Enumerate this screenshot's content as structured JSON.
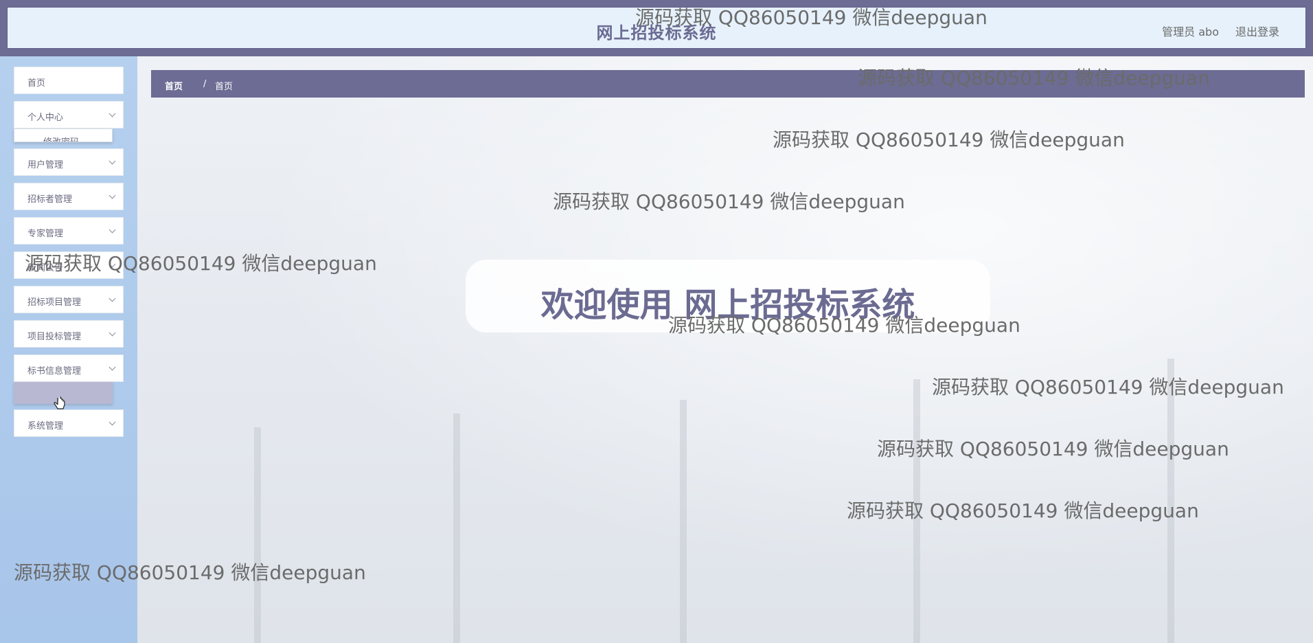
{
  "header": {
    "title": "网上招投标系统",
    "user_info": "管理员 abo",
    "logout_label": "退出登录"
  },
  "sidebar": {
    "items": [
      {
        "label": "首页",
        "has_arrow": false
      },
      {
        "label": "个人中心",
        "has_arrow": true
      },
      {
        "label": "用户管理",
        "has_arrow": true
      },
      {
        "label": "招标者管理",
        "has_arrow": true
      },
      {
        "label": "专家管理",
        "has_arrow": true
      },
      {
        "label": "新闻公告",
        "has_arrow": true
      },
      {
        "label": "招标项目管理",
        "has_arrow": true
      },
      {
        "label": "项目投标管理",
        "has_arrow": true
      },
      {
        "label": "标书信息管理",
        "has_arrow": true
      },
      {
        "label": "系统管理",
        "has_arrow": true
      }
    ],
    "submenu_label": "修改密码"
  },
  "breadcrumb": {
    "home": "首页",
    "separator": "/",
    "current": "首页"
  },
  "welcome": {
    "text": "欢迎使用 网上招投标系统"
  },
  "watermark": {
    "text": "源码获取 QQ86050149 微信deepguan"
  },
  "colors": {
    "header_bg": "#6c6c94",
    "accent": "#6b6b92",
    "sidebar_bg": "#b5d0ee"
  }
}
